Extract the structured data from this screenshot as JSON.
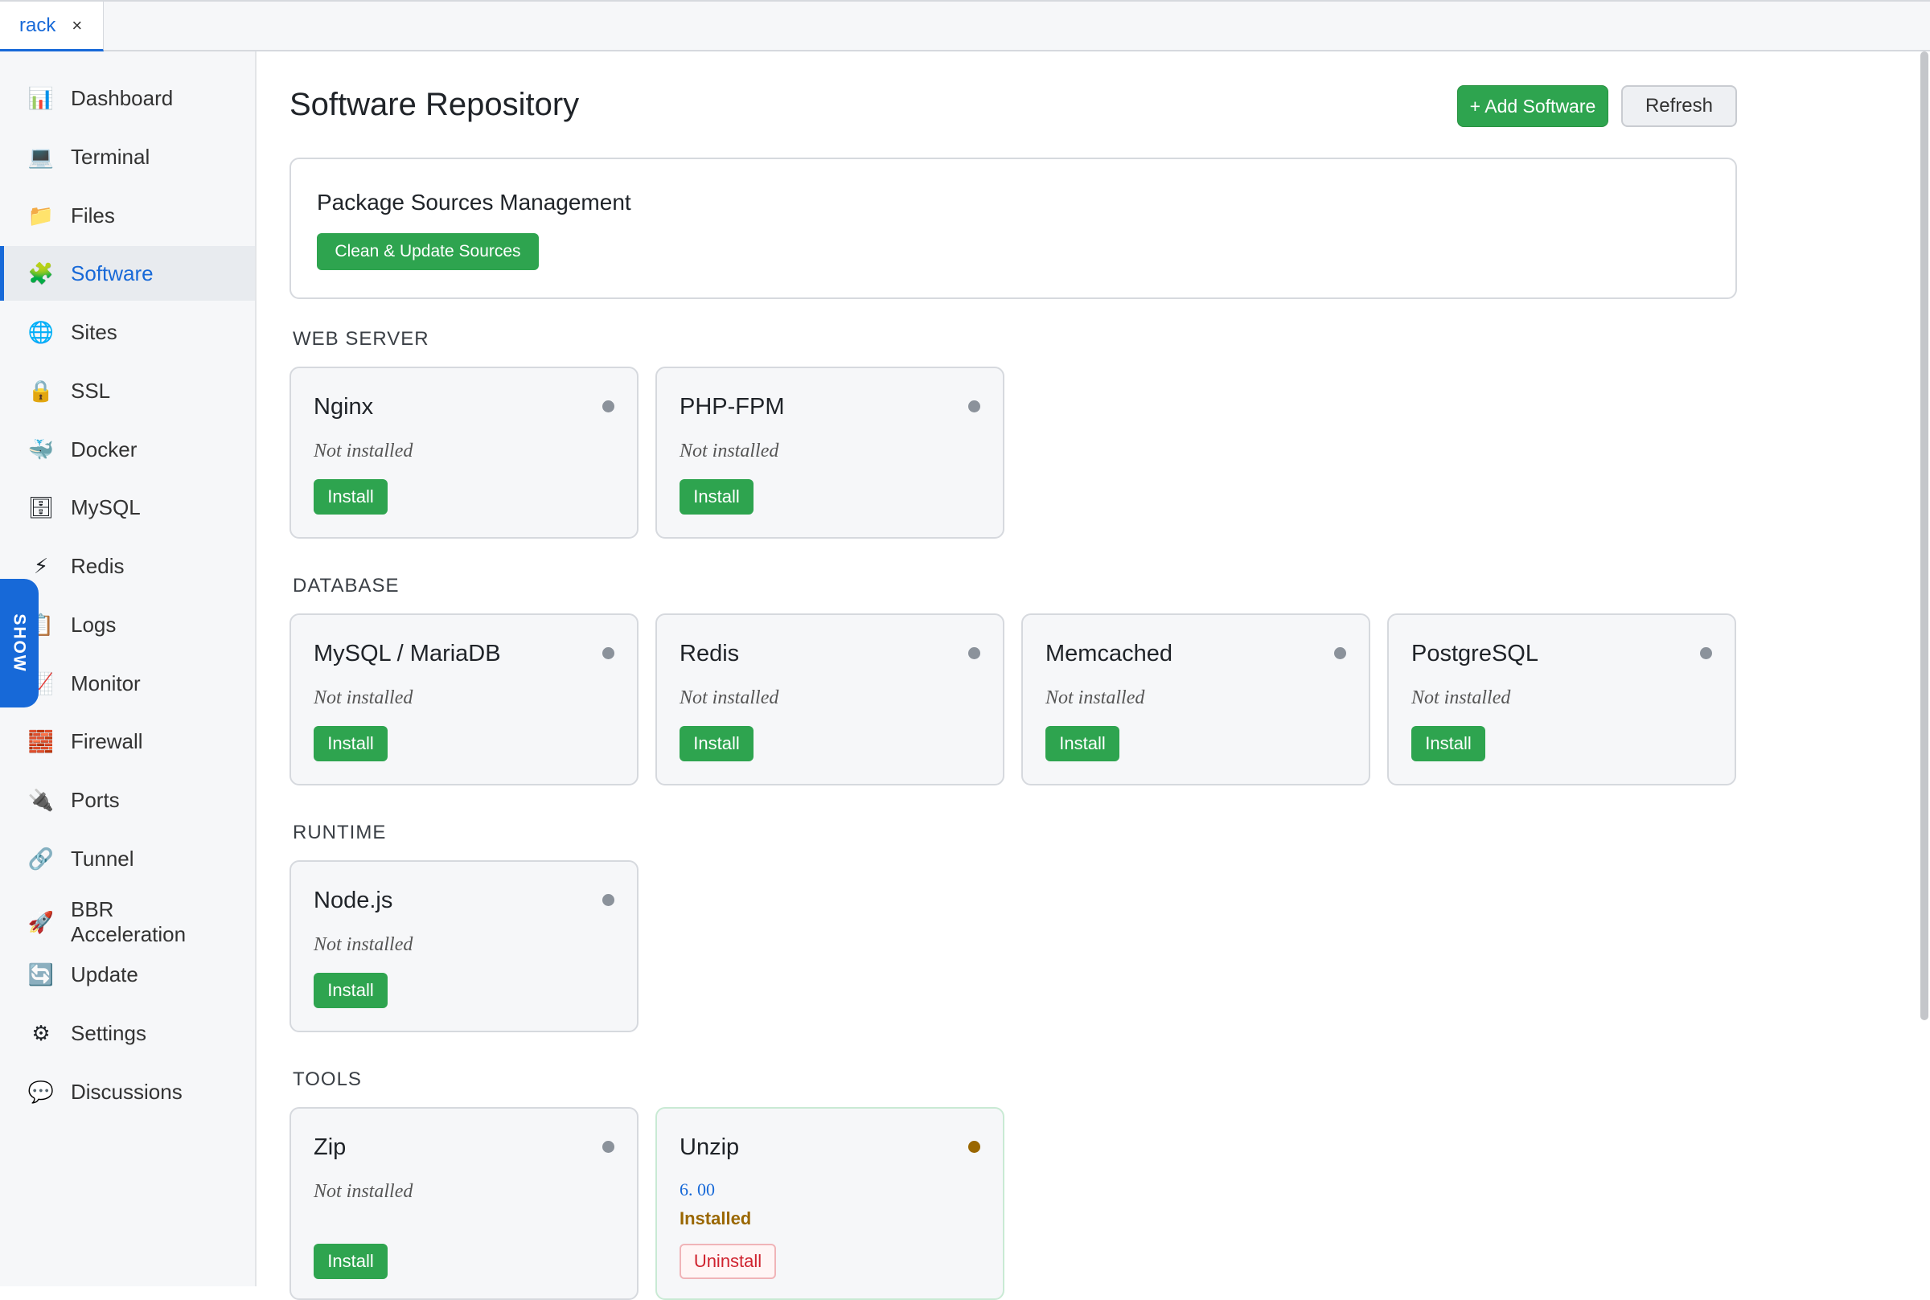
{
  "tab": {
    "label": "rack",
    "close": "×"
  },
  "sidebar": {
    "items": [
      {
        "label": "Dashboard",
        "icon": "📊"
      },
      {
        "label": "Terminal",
        "icon": "💻"
      },
      {
        "label": "Files",
        "icon": "📁"
      },
      {
        "label": "Software",
        "icon": "🧩",
        "active": true
      },
      {
        "label": "Sites",
        "icon": "🌐"
      },
      {
        "label": "SSL",
        "icon": "🔒"
      },
      {
        "label": "Docker",
        "icon": "🐳"
      },
      {
        "label": "MySQL",
        "icon": "🗄"
      },
      {
        "label": "Redis",
        "icon": "⚡"
      },
      {
        "label": "Logs",
        "icon": "📋"
      },
      {
        "label": "Monitor",
        "icon": "📈"
      },
      {
        "label": "Firewall",
        "icon": "🧱"
      },
      {
        "label": "Ports",
        "icon": "🔌"
      },
      {
        "label": "Tunnel",
        "icon": "🔗"
      },
      {
        "label": "BBR\nAcceleration",
        "icon": "🚀"
      },
      {
        "label": "Update",
        "icon": "🔄"
      },
      {
        "label": "Settings",
        "icon": "⚙"
      },
      {
        "label": "Discussions",
        "icon": "💬"
      }
    ]
  },
  "show_tab": "SHOW",
  "header": {
    "title": "Software Repository",
    "add_label": "+ Add Software",
    "refresh_label": "Refresh"
  },
  "sources": {
    "title": "Package Sources Management",
    "button": "Clean & Update Sources"
  },
  "sections": {
    "web": {
      "title": "WEB SERVER",
      "cards": [
        {
          "name": "Nginx",
          "status": "Not installed",
          "button": "Install"
        },
        {
          "name": "PHP-FPM",
          "status": "Not installed",
          "button": "Install"
        }
      ]
    },
    "database": {
      "title": "DATABASE",
      "cards": [
        {
          "name": "MySQL / MariaDB",
          "status": "Not installed",
          "button": "Install"
        },
        {
          "name": "Redis",
          "status": "Not installed",
          "button": "Install"
        },
        {
          "name": "Memcached",
          "status": "Not installed",
          "button": "Install"
        },
        {
          "name": "PostgreSQL",
          "status": "Not installed",
          "button": "Install"
        }
      ]
    },
    "runtime": {
      "title": "RUNTIME",
      "cards": [
        {
          "name": "Node.js",
          "status": "Not installed",
          "button": "Install"
        }
      ]
    },
    "tools": {
      "title": "TOOLS",
      "cards": [
        {
          "name": "Zip",
          "status": "Not installed",
          "button": "Install"
        },
        {
          "name": "Unzip",
          "version": "6. 00",
          "status": "Installed",
          "button": "Uninstall"
        }
      ]
    }
  },
  "colors": {
    "accent": "#1769d8",
    "install": "#2ea44f",
    "dot_idle": "#8b929b",
    "dot_installed": "#9a6700",
    "uninstall": "#cf222e"
  }
}
